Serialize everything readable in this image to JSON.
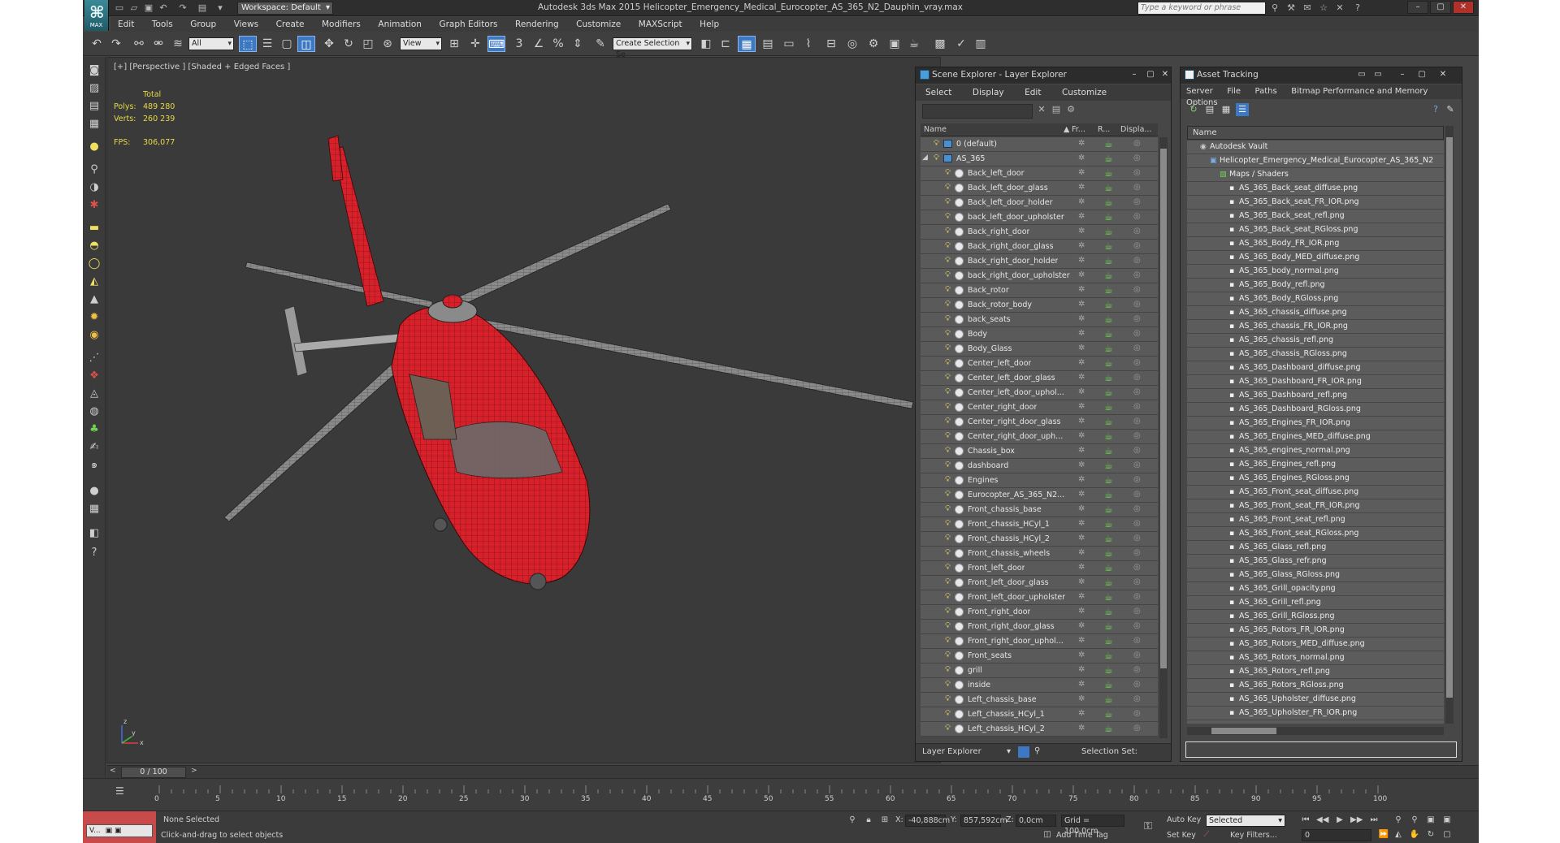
{
  "title_bar": {
    "app_logo": "MAX",
    "workspace": "Workspace: Default",
    "window_title": "Autodesk 3ds Max 2015      Helicopter_Emergency_Medical_Eurocopter_AS_365_N2_Dauphin_vray.max",
    "search_placeholder": "Type a keyword or phrase"
  },
  "menubar": [
    "Edit",
    "Tools",
    "Group",
    "Views",
    "Create",
    "Modifiers",
    "Animation",
    "Graph Editors",
    "Rendering",
    "Customize",
    "MAXScript",
    "Help"
  ],
  "toolbar": {
    "selection_filter": "All",
    "reference_coord": "View",
    "named_selection": "Create Selection Se",
    "snap_label": "3"
  },
  "viewport": {
    "label": "[+] [Perspective ] [Shaded + Edged Faces ]",
    "stats": {
      "header": "Total",
      "polys_label": "Polys:",
      "polys_value": "489 280",
      "verts_label": "Verts:",
      "verts_value": "260 239",
      "fps_label": "FPS:",
      "fps_value": "306,077"
    },
    "axis_x": "x",
    "axis_y": "y",
    "axis_z": "z"
  },
  "scene_explorer": {
    "title": "Scene Explorer - Layer Explorer",
    "menu": [
      "Select",
      "Display",
      "Edit",
      "Customize"
    ],
    "columns": {
      "name": "Name",
      "frozen": "Fr...",
      "render": "R...",
      "display": "Displa..."
    },
    "rows": [
      {
        "label": "0 (default)",
        "level": 0
      },
      {
        "label": "AS_365",
        "level": 0,
        "expanded": true
      },
      {
        "label": "Back_left_door",
        "level": 1
      },
      {
        "label": "Back_left_door_glass",
        "level": 1
      },
      {
        "label": "Back_left_door_holder",
        "level": 1
      },
      {
        "label": "back_left_door_upholster",
        "level": 1
      },
      {
        "label": "Back_right_door",
        "level": 1
      },
      {
        "label": "Back_right_door_glass",
        "level": 1
      },
      {
        "label": "Back_right_door_holder",
        "level": 1
      },
      {
        "label": "back_right_door_upholster",
        "level": 1
      },
      {
        "label": "Back_rotor",
        "level": 1
      },
      {
        "label": "Back_rotor_body",
        "level": 1
      },
      {
        "label": "back_seats",
        "level": 1
      },
      {
        "label": "Body",
        "level": 1
      },
      {
        "label": "Body_Glass",
        "level": 1
      },
      {
        "label": "Center_left_door",
        "level": 1
      },
      {
        "label": "Center_left_door_glass",
        "level": 1
      },
      {
        "label": "Center_left_door_uphol...",
        "level": 1
      },
      {
        "label": "Center_right_door",
        "level": 1
      },
      {
        "label": "Center_right_door_glass",
        "level": 1
      },
      {
        "label": "Center_right_door_uph...",
        "level": 1
      },
      {
        "label": "Chassis_box",
        "level": 1
      },
      {
        "label": "dashboard",
        "level": 1
      },
      {
        "label": "Engines",
        "level": 1
      },
      {
        "label": "Eurocopter_AS_365_N2...",
        "level": 1
      },
      {
        "label": "Front_chassis_base",
        "level": 1
      },
      {
        "label": "Front_chassis_HCyl_1",
        "level": 1
      },
      {
        "label": "Front_chassis_HCyl_2",
        "level": 1
      },
      {
        "label": "Front_chassis_wheels",
        "level": 1
      },
      {
        "label": "Front_left_door",
        "level": 1
      },
      {
        "label": "Front_left_door_glass",
        "level": 1
      },
      {
        "label": "Front_left_door_upholster",
        "level": 1
      },
      {
        "label": "Front_right_door",
        "level": 1
      },
      {
        "label": "Front_right_door_glass",
        "level": 1
      },
      {
        "label": "Front_right_door_uphol...",
        "level": 1
      },
      {
        "label": "Front_seats",
        "level": 1
      },
      {
        "label": "grill",
        "level": 1
      },
      {
        "label": "inside",
        "level": 1
      },
      {
        "label": "Left_chassis_base",
        "level": 1
      },
      {
        "label": "Left_chassis_HCyl_1",
        "level": 1
      },
      {
        "label": "Left_chassis_HCyl_2",
        "level": 1
      }
    ],
    "footer_explorer": "Layer Explorer",
    "footer_selection": "Selection Set:"
  },
  "asset_tracking": {
    "title": "Asset Tracking",
    "menu": [
      "Server",
      "File",
      "Paths",
      "Bitmap Performance and Memory",
      "Options"
    ],
    "column_name": "Name",
    "rows": [
      {
        "label": "Autodesk Vault",
        "level": 0,
        "icon": "vault"
      },
      {
        "label": "Helicopter_Emergency_Medical_Eurocopter_AS_365_N2",
        "level": 1,
        "icon": "max-file"
      },
      {
        "label": "Maps / Shaders",
        "level": 2,
        "icon": "maps"
      },
      {
        "label": "AS_365_Back_seat_diffuse.png",
        "level": 3,
        "icon": "bitmap"
      },
      {
        "label": "AS_365_Back_seat_FR_IOR.png",
        "level": 3,
        "icon": "bitmap"
      },
      {
        "label": "AS_365_Back_seat_refl.png",
        "level": 3,
        "icon": "bitmap"
      },
      {
        "label": "AS_365_Back_seat_RGloss.png",
        "level": 3,
        "icon": "bitmap"
      },
      {
        "label": "AS_365_Body_FR_IOR.png",
        "level": 3,
        "icon": "bitmap"
      },
      {
        "label": "AS_365_Body_MED_diffuse.png",
        "level": 3,
        "icon": "bitmap"
      },
      {
        "label": "AS_365_body_normal.png",
        "level": 3,
        "icon": "bitmap"
      },
      {
        "label": "AS_365_Body_refl.png",
        "level": 3,
        "icon": "bitmap"
      },
      {
        "label": "AS_365_Body_RGloss.png",
        "level": 3,
        "icon": "bitmap"
      },
      {
        "label": "AS_365_chassis_diffuse.png",
        "level": 3,
        "icon": "bitmap"
      },
      {
        "label": "AS_365_chassis_FR_IOR.png",
        "level": 3,
        "icon": "bitmap"
      },
      {
        "label": "AS_365_chassis_refl.png",
        "level": 3,
        "icon": "bitmap"
      },
      {
        "label": "AS_365_chassis_RGloss.png",
        "level": 3,
        "icon": "bitmap"
      },
      {
        "label": "AS_365_Dashboard_diffuse.png",
        "level": 3,
        "icon": "bitmap"
      },
      {
        "label": "AS_365_Dashboard_FR_IOR.png",
        "level": 3,
        "icon": "bitmap"
      },
      {
        "label": "AS_365_Dashboard_refl.png",
        "level": 3,
        "icon": "bitmap"
      },
      {
        "label": "AS_365_Dashboard_RGloss.png",
        "level": 3,
        "icon": "bitmap"
      },
      {
        "label": "AS_365_Engines_FR_IOR.png",
        "level": 3,
        "icon": "bitmap"
      },
      {
        "label": "AS_365_Engines_MED_diffuse.png",
        "level": 3,
        "icon": "bitmap"
      },
      {
        "label": "AS_365_engines_normal.png",
        "level": 3,
        "icon": "bitmap"
      },
      {
        "label": "AS_365_Engines_refl.png",
        "level": 3,
        "icon": "bitmap"
      },
      {
        "label": "AS_365_Engines_RGloss.png",
        "level": 3,
        "icon": "bitmap"
      },
      {
        "label": "AS_365_Front_seat_diffuse.png",
        "level": 3,
        "icon": "bitmap"
      },
      {
        "label": "AS_365_Front_seat_FR_IOR.png",
        "level": 3,
        "icon": "bitmap"
      },
      {
        "label": "AS_365_Front_seat_refl.png",
        "level": 3,
        "icon": "bitmap"
      },
      {
        "label": "AS_365_Front_seat_RGloss.png",
        "level": 3,
        "icon": "bitmap"
      },
      {
        "label": "AS_365_Glass_refl.png",
        "level": 3,
        "icon": "bitmap"
      },
      {
        "label": "AS_365_Glass_refr.png",
        "level": 3,
        "icon": "bitmap"
      },
      {
        "label": "AS_365_Glass_RGloss.png",
        "level": 3,
        "icon": "bitmap"
      },
      {
        "label": "AS_365_Grill_opacity.png",
        "level": 3,
        "icon": "bitmap"
      },
      {
        "label": "AS_365_Grill_refl.png",
        "level": 3,
        "icon": "bitmap"
      },
      {
        "label": "AS_365_Grill_RGloss.png",
        "level": 3,
        "icon": "bitmap"
      },
      {
        "label": "AS_365_Rotors_FR_IOR.png",
        "level": 3,
        "icon": "bitmap"
      },
      {
        "label": "AS_365_Rotors_MED_diffuse.png",
        "level": 3,
        "icon": "bitmap"
      },
      {
        "label": "AS_365_Rotors_normal.png",
        "level": 3,
        "icon": "bitmap"
      },
      {
        "label": "AS_365_Rotors_refl.png",
        "level": 3,
        "icon": "bitmap"
      },
      {
        "label": "AS_365_Rotors_RGloss.png",
        "level": 3,
        "icon": "bitmap"
      },
      {
        "label": "AS_365_Upholster_diffuse.png",
        "level": 3,
        "icon": "bitmap"
      },
      {
        "label": "AS_365_Upholster_FR_IOR.png",
        "level": 3,
        "icon": "bitmap"
      }
    ]
  },
  "time_slider": {
    "position": "0 / 100"
  },
  "trackbar": {
    "ticks": [
      "0",
      "5",
      "10",
      "15",
      "20",
      "25",
      "30",
      "35",
      "40",
      "45",
      "50",
      "55",
      "60",
      "65",
      "70",
      "75",
      "80",
      "85",
      "90",
      "95",
      "100"
    ]
  },
  "status_bar": {
    "selection": "None Selected",
    "prompt": "Click-and-drag to select objects",
    "mini_listener": "V...",
    "x_label": "X:",
    "x_value": "-40,888cm",
    "y_label": "Y:",
    "y_value": "857,592cm",
    "z_label": "Z:",
    "z_value": "0,0cm",
    "grid": "Grid = 100,0cm",
    "add_time_tag": "Add Time Tag",
    "auto_key": "Auto Key",
    "set_key": "Set Key",
    "key_mode": "Selected",
    "key_filters": "Key Filters...",
    "frame": "0"
  },
  "colors": {
    "accent_blue": "#3d78c3",
    "helicopter_red": "#d8202a",
    "stats_yellow": "#e8d84a",
    "render_green": "#6fd34f"
  }
}
